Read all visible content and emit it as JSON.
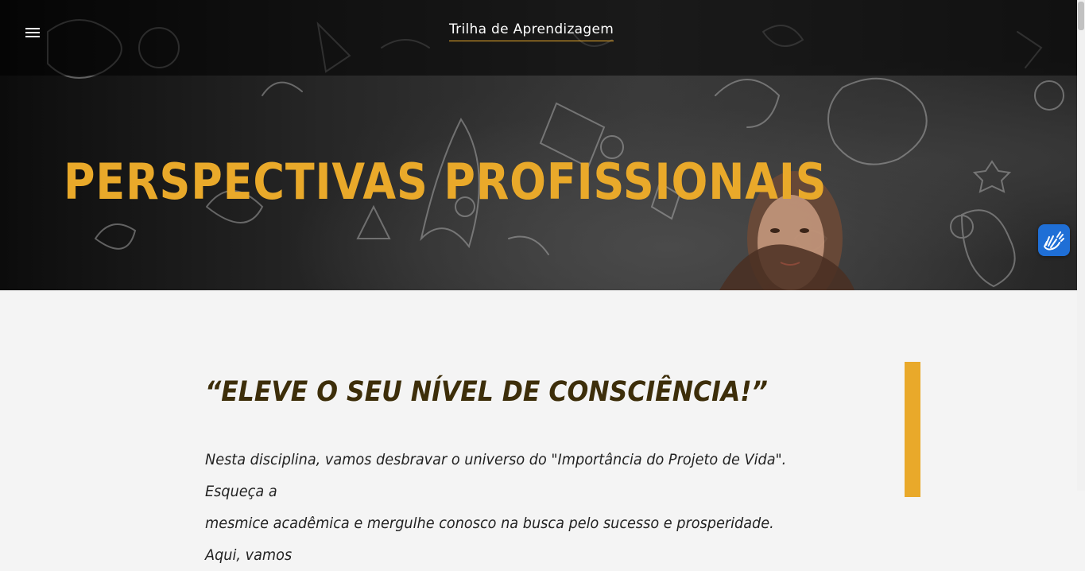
{
  "header": {
    "site_title": "Trilha de Aprendizagem",
    "menu_icon": "hamburger-menu-icon"
  },
  "hero": {
    "title": "PERSPECTIVAS PROFISSIONAIS",
    "background": "chalkboard-doodles-illustration"
  },
  "accessibility": {
    "icon": "sign-language-hands-icon",
    "color": "#1f6fd6"
  },
  "content": {
    "quote_title": "“ELEVE O SEU NÍVEL DE CONSCIÊNCIA!”",
    "intro_line_1": "Nesta disciplina, vamos desbravar o universo do \"Importância do Projeto de Vida\". Esqueça a",
    "intro_line_2": "mesmice acadêmica e mergulhe conosco na busca pelo sucesso e prosperidade. Aqui, vamos"
  },
  "colors": {
    "accent": "#e9a92a",
    "quote_text": "#3d2e0a",
    "page_background": "#f4f4f4"
  }
}
